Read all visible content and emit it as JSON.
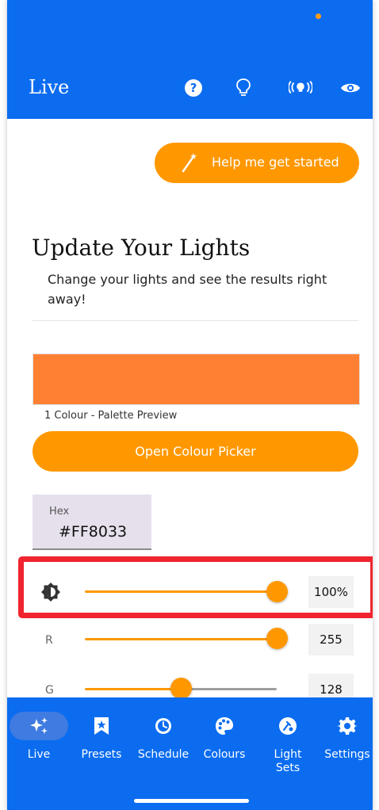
{
  "header": {
    "title": "Live",
    "icons": [
      "help-icon",
      "bulb-icon",
      "broadcast-icon",
      "eye-icon"
    ]
  },
  "help_button": {
    "label": "Help me get started",
    "icon": "magic-wand-icon"
  },
  "section": {
    "title": "Update Your Lights",
    "subtitle": "Change your lights and see the results right away!"
  },
  "palette": {
    "color": "#FF8033",
    "label": "1 Colour - Palette Preview",
    "open_picker_label": "Open Colour Picker"
  },
  "hex_field": {
    "label": "Hex",
    "value": "#FF8033"
  },
  "sliders": [
    {
      "name": "brightness",
      "icon": "brightness-icon",
      "label": "",
      "value_text": "100%",
      "fraction": 1.0
    },
    {
      "name": "red",
      "label": "R",
      "value_text": "255",
      "fraction": 1.0
    },
    {
      "name": "green",
      "label": "G",
      "value_text": "128",
      "fraction": 0.5
    }
  ],
  "nav": {
    "items": [
      {
        "label": "Live",
        "icon": "sparkles-icon",
        "active": true
      },
      {
        "label": "Presets",
        "icon": "bookmark-star-icon",
        "active": false
      },
      {
        "label": "Schedule",
        "icon": "clock-icon",
        "active": false
      },
      {
        "label": "Colours",
        "icon": "palette-icon",
        "active": false
      },
      {
        "label": "Light\nSets",
        "icon": "light-sets-icon",
        "active": false
      },
      {
        "label": "Settings",
        "icon": "gear-icon",
        "active": false
      }
    ]
  },
  "colors": {
    "primary": "#0B6CF0",
    "accent": "#FF9800",
    "preview": "#FF8033",
    "highlight": "#F0242E"
  }
}
